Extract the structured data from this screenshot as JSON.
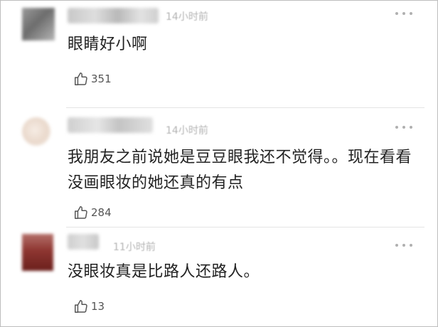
{
  "comments": [
    {
      "time": "14小时前",
      "text": "眼睛好小啊",
      "likes": "351"
    },
    {
      "time": "14小时前",
      "text": "我朋友之前说她是豆豆眼我还不觉得。。现在看看没画眼妆的她还真的有点",
      "likes": "284"
    },
    {
      "time": "11小时前",
      "text": "没眼妆真是比路人还路人。",
      "likes": "13"
    }
  ],
  "icons": {
    "like": "thumbs-up-icon",
    "more": "more-dots-icon"
  },
  "colors": {
    "text": "#222222",
    "muted": "#b4b4b4",
    "divider": "#e4e4e4"
  }
}
